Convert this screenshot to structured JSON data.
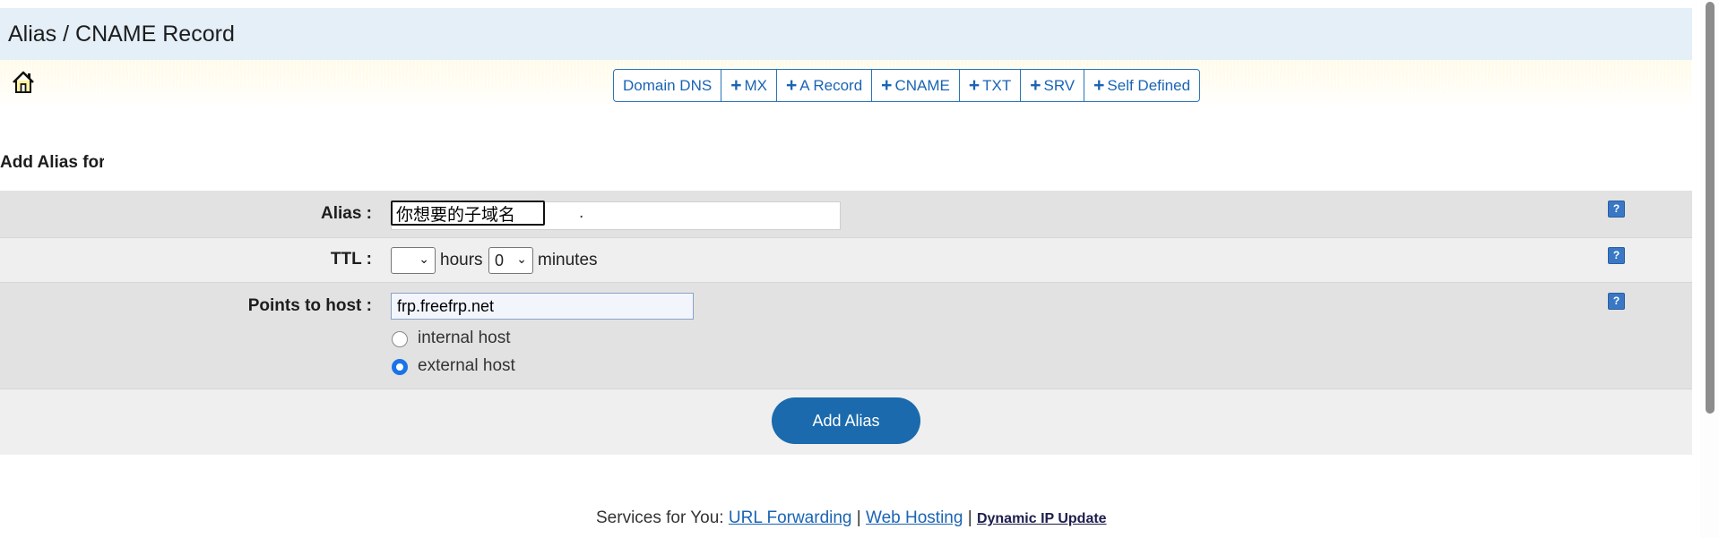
{
  "page": {
    "title": "Alias / CNAME Record"
  },
  "toolbar": {
    "home_icon": "home-icon",
    "buttons": [
      {
        "label": "Domain DNS",
        "plus": false
      },
      {
        "label": "MX",
        "plus": true
      },
      {
        "label": "A Record",
        "plus": true
      },
      {
        "label": "CNAME",
        "plus": true
      },
      {
        "label": "TXT",
        "plus": true
      },
      {
        "label": "SRV",
        "plus": true
      },
      {
        "label": "Self Defined",
        "plus": true
      }
    ],
    "plus_glyph": "+"
  },
  "section": {
    "heading": "Add Alias for"
  },
  "form": {
    "alias": {
      "label": "Alias :",
      "value": "你想要的子域名",
      "suffix": "."
    },
    "ttl": {
      "label": "TTL :",
      "hours_value": "",
      "hours_unit": "hours",
      "minutes_value": "0",
      "minutes_unit": "minutes"
    },
    "host": {
      "label": "Points to host :",
      "value": "frp.freefrp.net",
      "options": [
        {
          "label": "internal host",
          "checked": false
        },
        {
          "label": "external host",
          "checked": true
        }
      ]
    },
    "help_glyph": "?",
    "submit_label": "Add Alias"
  },
  "footer": {
    "prefix": "Services for You:",
    "links": [
      "URL Forwarding",
      "Web Hosting",
      "Dynamic IP Update"
    ],
    "separator": "|"
  },
  "colors": {
    "accent": "#1a6aad",
    "link": "#1a64b4",
    "title_bar": "#e4eff8"
  }
}
